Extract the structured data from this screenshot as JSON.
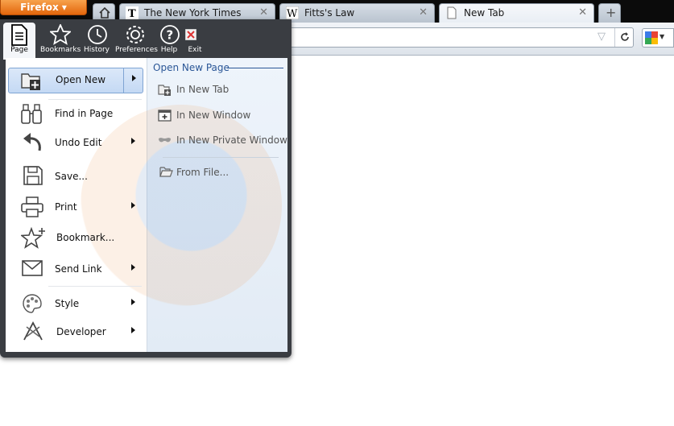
{
  "app_button": "Firefox ▾",
  "tabs": [
    {
      "label": "The New York Times",
      "favicon": "nyt-icon",
      "close": "✕"
    },
    {
      "label": "Fitts's Law",
      "favicon": "wikipedia-icon",
      "close": "✕"
    },
    {
      "label": "New Tab",
      "favicon": "page-icon",
      "close": "✕"
    }
  ],
  "new_tab_button": "+",
  "menu": {
    "top_icons": [
      {
        "label": "Page",
        "icon": "page-icon"
      },
      {
        "label": "Bookmarks",
        "icon": "bookmarks-star-icon"
      },
      {
        "label": "History",
        "icon": "history-clock-icon"
      },
      {
        "label": "Preferences",
        "icon": "gear-icon"
      },
      {
        "label": "Help",
        "icon": "help-icon"
      },
      {
        "label": "Exit",
        "icon": "exit-icon"
      }
    ],
    "items": [
      {
        "label": "Open New",
        "icon": "folder-plus-icon",
        "submenu": true
      },
      {
        "label": "Find in Page",
        "icon": "binoculars-icon",
        "submenu": false
      },
      {
        "label": "Undo Edit",
        "icon": "undo-icon",
        "submenu": true
      },
      {
        "label": "Save...",
        "icon": "save-icon",
        "submenu": false
      },
      {
        "label": "Print",
        "icon": "printer-icon",
        "submenu": true
      },
      {
        "label": "Bookmark...",
        "icon": "star-plus-icon",
        "submenu": false
      },
      {
        "label": "Send Link",
        "icon": "envelope-icon",
        "submenu": true
      },
      {
        "label": "Style",
        "icon": "palette-icon",
        "submenu": true
      },
      {
        "label": "Developer",
        "icon": "tools-icon",
        "submenu": true
      }
    ],
    "submenu": {
      "title": "Open New Page",
      "items": [
        {
          "label": "In New Tab",
          "icon": "new-tab-icon"
        },
        {
          "label": "In New Window",
          "icon": "new-window-icon"
        },
        {
          "label": "In New Private Window",
          "icon": "private-window-icon"
        },
        {
          "label": "From File...",
          "icon": "open-folder-icon"
        }
      ]
    }
  },
  "colors": {
    "accent": "#2b5797",
    "firefox_orange": "#e3660c",
    "highlight": "#c4d9f4"
  }
}
